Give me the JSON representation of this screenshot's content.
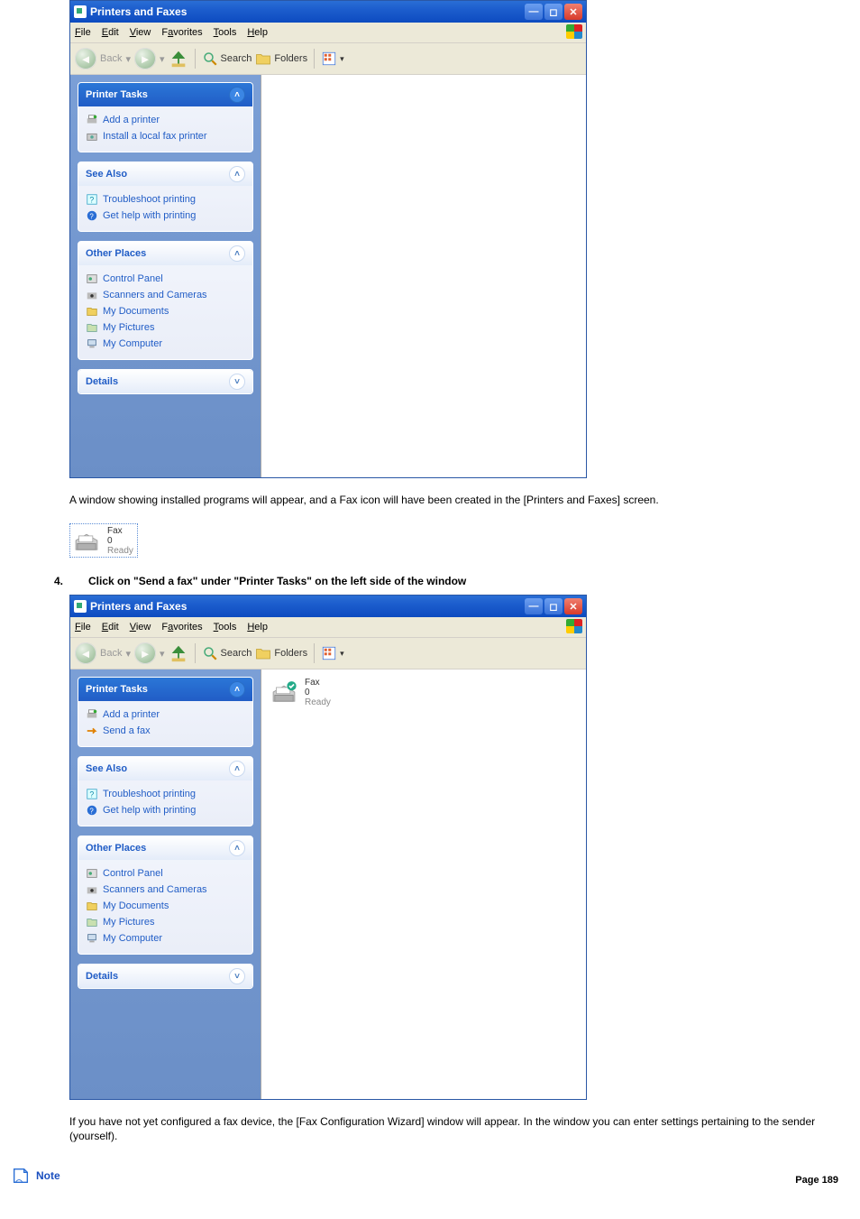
{
  "win1": {
    "title": "Printers and Faxes",
    "menu": [
      "File",
      "Edit",
      "View",
      "Favorites",
      "Tools",
      "Help"
    ],
    "toolbar": {
      "back": "Back",
      "search": "Search",
      "folders": "Folders"
    },
    "panes": {
      "printer_tasks": {
        "title": "Printer Tasks",
        "items": [
          "Add a printer",
          "Install a local fax printer"
        ]
      },
      "see_also": {
        "title": "See Also",
        "items": [
          "Troubleshoot printing",
          "Get help with printing"
        ]
      },
      "other_places": {
        "title": "Other Places",
        "items": [
          "Control Panel",
          "Scanners and Cameras",
          "My Documents",
          "My Pictures",
          "My Computer"
        ]
      },
      "details": {
        "title": "Details"
      }
    }
  },
  "para1": "A window showing installed programs will appear, and a Fax icon will have been created in the [Printers and Faxes] screen.",
  "fax_small": {
    "name": "Fax",
    "docs": "0",
    "status": "Ready"
  },
  "step4_num": "4.",
  "step4_text": "Click on \"Send a fax\" under \"Printer Tasks\" on the left side of the window",
  "win2": {
    "title": "Printers and Faxes",
    "menu": [
      "File",
      "Edit",
      "View",
      "Favorites",
      "Tools",
      "Help"
    ],
    "toolbar": {
      "back": "Back",
      "search": "Search",
      "folders": "Folders"
    },
    "panes": {
      "printer_tasks": {
        "title": "Printer Tasks",
        "items": [
          "Add a printer",
          "Send a fax"
        ]
      },
      "see_also": {
        "title": "See Also",
        "items": [
          "Troubleshoot printing",
          "Get help with printing"
        ]
      },
      "other_places": {
        "title": "Other Places",
        "items": [
          "Control Panel",
          "Scanners and Cameras",
          "My Documents",
          "My Pictures",
          "My Computer"
        ]
      },
      "details": {
        "title": "Details"
      }
    },
    "fax_item": {
      "name": "Fax",
      "docs": "0",
      "status": "Ready"
    }
  },
  "para2": "If you have not yet configured a fax device, the [Fax Configuration Wizard] window will appear. In the window you can enter settings pertaining to the sender (yourself).",
  "note_label": "Note",
  "page_label": "Page 189"
}
